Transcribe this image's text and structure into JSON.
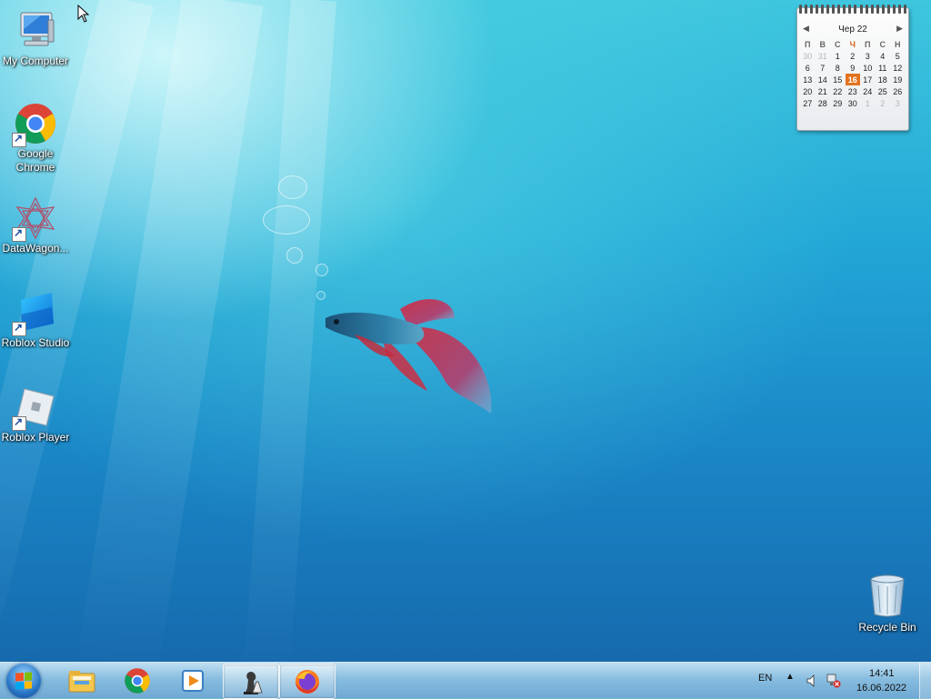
{
  "desktop": {
    "icons": [
      {
        "label": "My Computer",
        "icon": "computer-icon"
      },
      {
        "label": "Google Chrome",
        "icon": "chrome-icon"
      },
      {
        "label": "DataWagon...",
        "icon": "datawagon-icon"
      },
      {
        "label": "Roblox Studio",
        "icon": "roblox-studio-icon"
      },
      {
        "label": "Roblox Player",
        "icon": "roblox-player-icon"
      }
    ],
    "recycle_bin": {
      "label": "Recycle Bin",
      "icon": "recycle-bin-icon"
    }
  },
  "calendar_gadget": {
    "month_label": "Чер 22",
    "weekdays": [
      "П",
      "В",
      "С",
      "Ч",
      "П",
      "С",
      "Н"
    ],
    "highlighted_weekday_index": 3,
    "weeks": [
      [
        "30",
        "31",
        "1",
        "2",
        "3",
        "4",
        "5"
      ],
      [
        "6",
        "7",
        "8",
        "9",
        "10",
        "11",
        "12"
      ],
      [
        "13",
        "14",
        "15",
        "16",
        "17",
        "18",
        "19"
      ],
      [
        "20",
        "21",
        "22",
        "23",
        "24",
        "25",
        "26"
      ],
      [
        "27",
        "28",
        "29",
        "30",
        "1",
        "2",
        "3"
      ]
    ],
    "today": "16",
    "accent_color": "#e2731e"
  },
  "taskbar": {
    "start_button": "windows-start-icon",
    "items": [
      {
        "icon": "file-explorer-icon",
        "active": false
      },
      {
        "icon": "chrome-icon",
        "active": false
      },
      {
        "icon": "media-player-icon",
        "active": false
      },
      {
        "icon": "chess-icon",
        "active": true
      },
      {
        "icon": "firefox-icon",
        "active": true
      }
    ],
    "tray": {
      "language": "EN",
      "time": "14:41",
      "date": "16.06.2022",
      "icons": [
        "show-hidden-icons-chevron",
        "volume-icon",
        "network-disconnected-icon"
      ]
    }
  }
}
